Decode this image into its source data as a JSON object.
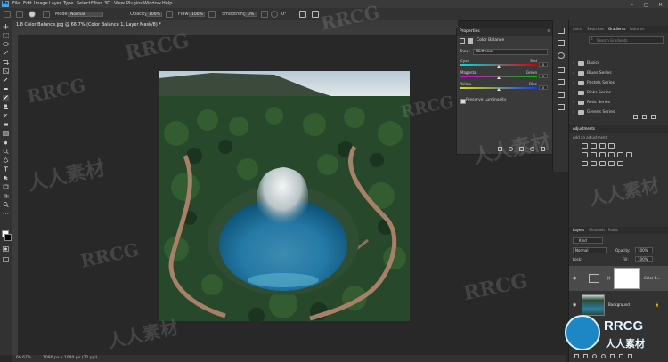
{
  "menubar": {
    "logo": "Ps",
    "items": [
      "File",
      "Edit",
      "Image",
      "Layer",
      "Type",
      "Select",
      "Filter",
      "3D",
      "View",
      "Plugins",
      "Window",
      "Help"
    ]
  },
  "options": {
    "mode_label": "Mode:",
    "mode_value": "Normal",
    "opacity_label": "Opacity:",
    "opacity_value": "100%",
    "flow_label": "Flow:",
    "flow_value": "100%",
    "smoothing_label": "Smoothing:",
    "smoothing_value": "0%",
    "angle_value": "0°"
  },
  "document": {
    "tab_title": "1.8 Color Balance.jpg @ 66.7% (Color Balance 1, Layer Mask/8) *"
  },
  "status": {
    "zoom": "66.67%",
    "doc_info": "1080 px x 1080 px (72 ppi)"
  },
  "properties": {
    "header": "Properties",
    "title": "Color Balance",
    "tone_label": "Tone:",
    "tone_value": "Midtones",
    "sliders": [
      {
        "left": "Cyan",
        "right": "Red",
        "value": "0"
      },
      {
        "left": "Magenta",
        "right": "Green",
        "value": "0"
      },
      {
        "left": "Yellow",
        "right": "Blue",
        "value": "0"
      }
    ],
    "preserve_label": "Preserve Luminosity"
  },
  "right_panels": {
    "top_tabs": [
      "Color",
      "Swatches",
      "Gradients",
      "Patterns"
    ],
    "active_tab": "Gradients",
    "search_placeholder": "Search Gradients",
    "gradient_folders": [
      "Basics",
      "Blues Series",
      "Pastels Series",
      "Pinks Series",
      "Reds Series",
      "Greens Series"
    ],
    "adjustments_header": "Adjustments",
    "adjustments_subtitle": "Add an adjustment",
    "layers_tabs": [
      "Layers",
      "Channels",
      "Paths"
    ],
    "kind_label": "Kind",
    "blend_mode": "Normal",
    "opacity_label": "Opacity:",
    "opacity_value": "100%",
    "lock_label": "Lock:",
    "fill_label": "Fill:",
    "fill_value": "100%",
    "layers": [
      {
        "name": "Color B...",
        "type": "adjustment"
      },
      {
        "name": "Background",
        "type": "image"
      }
    ]
  },
  "watermarks": [
    "RRCG",
    "人人素材"
  ],
  "colors": {
    "accent": "#31a8ff",
    "panel": "#323232",
    "canvas": "#282828"
  }
}
